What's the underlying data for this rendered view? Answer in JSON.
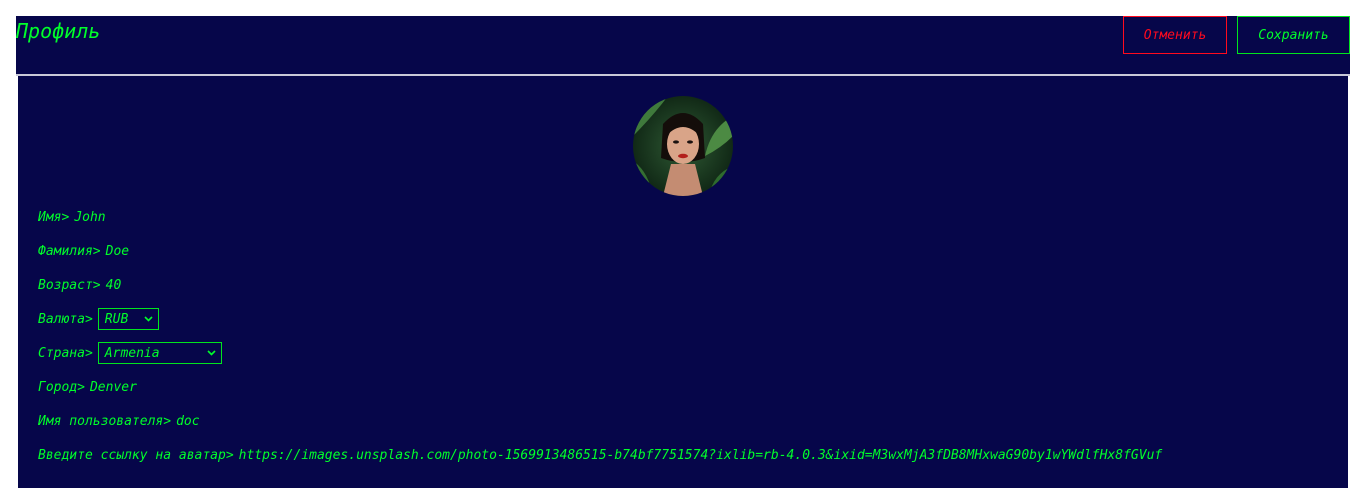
{
  "header": {
    "title": "Профиль",
    "cancel_label": "Отменить",
    "save_label": "Сохранить"
  },
  "profile": {
    "avatar_icon": "avatar-photo",
    "fields": {
      "first_name": {
        "label": "Имя>",
        "value": "John"
      },
      "last_name": {
        "label": "Фамилия>",
        "value": "Doe"
      },
      "age": {
        "label": "Возраст>",
        "value": "40"
      },
      "currency": {
        "label": "Валюта>",
        "value": "RUB"
      },
      "country": {
        "label": "Страна>",
        "value": "Armenia"
      },
      "city": {
        "label": "Город>",
        "value": "Denver"
      },
      "username": {
        "label": "Имя пользователя>",
        "value": "doc"
      },
      "avatar_url": {
        "label": "Введите ссылку на аватар>",
        "value": "https://images.unsplash.com/photo-1569913486515-b74bf7751574?ixlib=rb-4.0.3&ixid=M3wxMjA3fDB8MHxwaG90by1wYWdlfHx8fGVuf"
      }
    }
  },
  "colors": {
    "background": "#06064a",
    "accent": "#00ff2a",
    "danger": "#ff0a1e"
  }
}
